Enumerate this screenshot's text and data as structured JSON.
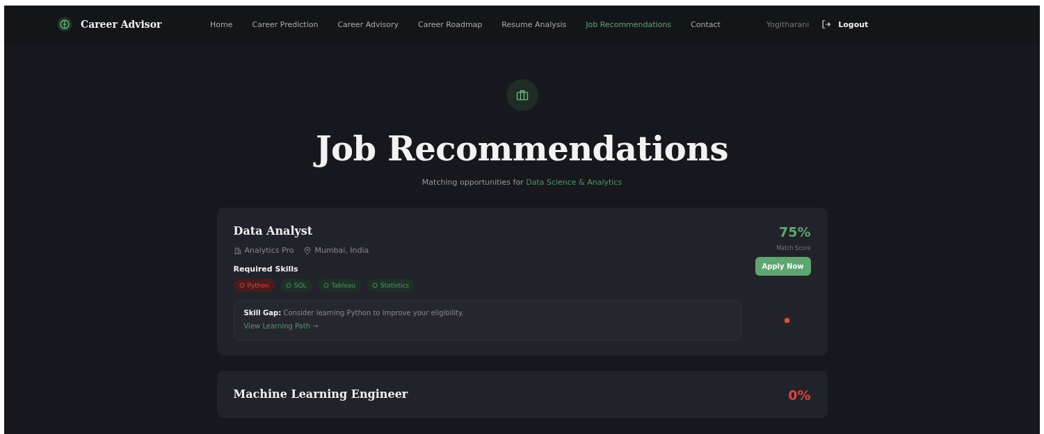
{
  "brand": {
    "name": "Career Advisor"
  },
  "nav": [
    {
      "label": "Home",
      "selected": false
    },
    {
      "label": "Career Prediction",
      "selected": false
    },
    {
      "label": "Career Advisory",
      "selected": false
    },
    {
      "label": "Career Roadmap",
      "selected": false
    },
    {
      "label": "Resume Analysis",
      "selected": false
    },
    {
      "label": "Job Recommendations",
      "selected": true
    },
    {
      "label": "Contact",
      "selected": false
    }
  ],
  "user": {
    "name": "Yogitharani",
    "logout": "Logout"
  },
  "header": {
    "title": "Job Recommendations",
    "subtitle": "Matching opportunities for",
    "field": "Data Science & Analytics"
  },
  "jobs": [
    {
      "title": "Data Analyst",
      "company": "Analytics Pro",
      "location": "Mumbai, India",
      "score": "75%",
      "kind": "good",
      "score_label": "Match Score",
      "apply": "Apply Now",
      "skills_heading": "Required Skills",
      "skills": [
        {
          "name": "Python",
          "have": false
        },
        {
          "name": "SQL",
          "have": true
        },
        {
          "name": "Tableau",
          "have": true
        },
        {
          "name": "Statistics",
          "have": true
        }
      ],
      "gap": {
        "label": "Skill Gap:",
        "text": "Consider learning Python to improve your eligibility.",
        "link": "View Learning Path →"
      }
    },
    {
      "title": "Machine Learning Engineer",
      "score": "0%",
      "kind": "poor"
    }
  ]
}
